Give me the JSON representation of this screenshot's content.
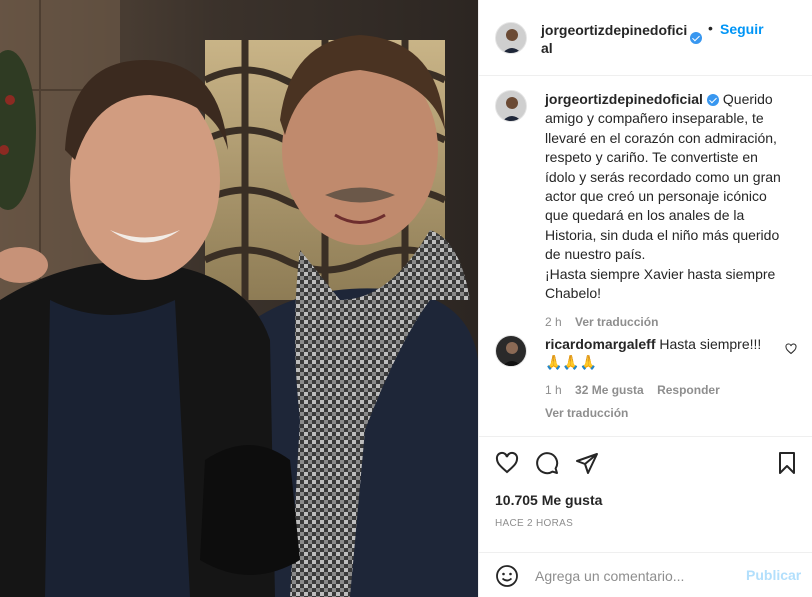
{
  "post": {
    "author": "jorgeortizdepinedoficial",
    "follow_label": "Seguir",
    "dot": "•",
    "caption_lines": [
      "Querido",
      "amigo y compañero inseparable, te",
      "llevaré en el corazón con admiración,",
      "respeto y cariño. Te convertiste en",
      "ídolo y serás recordado como un gran",
      "actor que creó un personaje icónico",
      "que quedará en los anales de la",
      "Historia, sin duda el niño más querido",
      "de nuestro país.",
      "¡Hasta siempre Xavier hasta siempre",
      "Chabelo!"
    ],
    "caption_age": "2 h",
    "translate_label": "Ver traducción",
    "likes": "10.705 Me gusta",
    "posted": "HACE 2 HORAS"
  },
  "comment": {
    "user": "ricardomargaleff",
    "text": "Hasta siempre!!!",
    "emojis": "🙏🙏🙏",
    "age": "1 h",
    "likes": "32 Me gusta",
    "reply_label": "Responder",
    "translate_label": "Ver traducción"
  },
  "composer": {
    "placeholder": "Agrega un comentario...",
    "publish_label": "Publicar"
  },
  "icons": {
    "like": "heart-icon",
    "comment": "comment-icon",
    "share": "share-icon",
    "save": "bookmark-icon",
    "emoji": "emoji-icon",
    "verified": "verified-badge-icon"
  },
  "colors": {
    "accent": "#0095f6",
    "verified": "#3897f0",
    "muted": "#8e8e8e"
  }
}
